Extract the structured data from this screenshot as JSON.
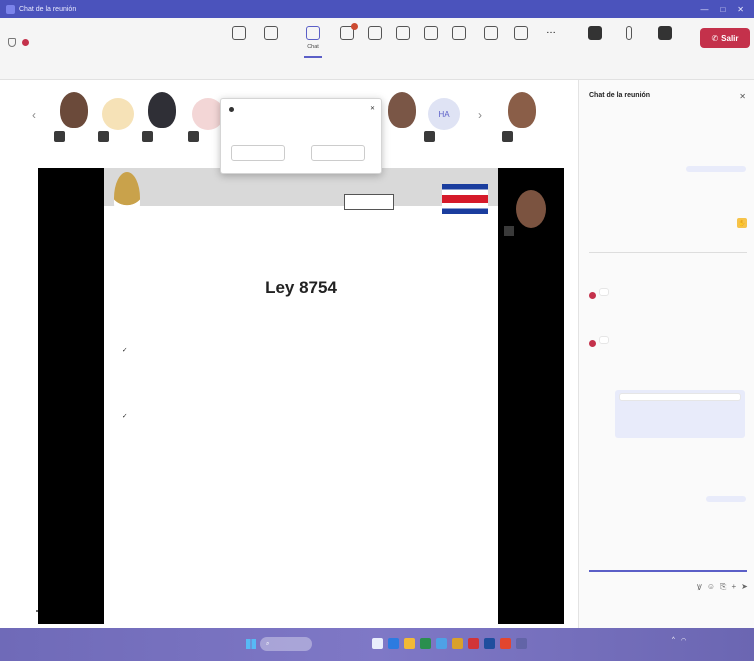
{
  "window": {
    "title": "Chat de la reunión",
    "controls": [
      "—",
      "□",
      "✕"
    ]
  },
  "toolbar": {
    "timer": "",
    "buttons": [
      "",
      "",
      "Chat",
      "",
      "",
      "",
      "",
      "",
      "",
      "",
      ""
    ],
    "right_buttons": [
      "",
      "",
      ""
    ],
    "leave_label": "Salir"
  },
  "participants": {
    "initials": [
      "",
      "",
      "HA"
    ]
  },
  "popup": {
    "title": "",
    "body": "",
    "link": "",
    "btn1": "",
    "btn2": ""
  },
  "tooltip": "",
  "slide": {
    "title": "Ley 8754",
    "bullets": [
      {
        "label": "",
        "text": ""
      },
      {
        "label": "",
        "text": ""
      }
    ]
  },
  "camera_label": "",
  "chat": {
    "header": "Chat de la reunión",
    "messages": [
      {
        "sender": "",
        "text": ""
      },
      {
        "sender": "",
        "text": ""
      },
      {
        "sender": "",
        "text": ""
      },
      {
        "sender": "",
        "text": ""
      },
      {
        "sender": "",
        "text": ""
      },
      {
        "sender": "",
        "text": ""
      },
      {
        "sender": "",
        "text": ""
      },
      {
        "sender": "",
        "text": ""
      }
    ],
    "divider": "",
    "compose_placeholder": ""
  },
  "taskbar": {
    "search": "",
    "time": ""
  },
  "colors": {
    "teams_purple": "#5b5fc7",
    "leave_red": "#c4314b",
    "title_bar": "#4b53bc"
  }
}
